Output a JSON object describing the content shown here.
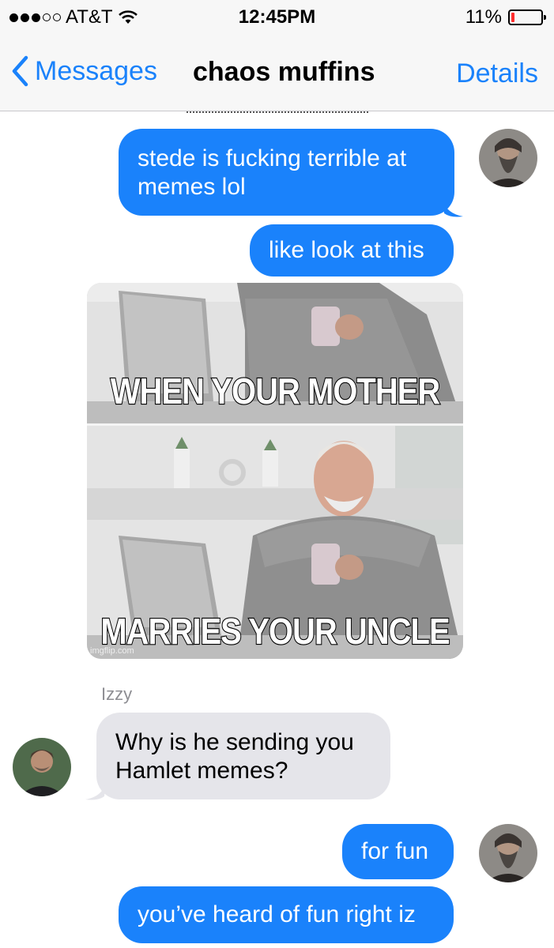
{
  "status_bar": {
    "carrier": "AT&T",
    "time": "12:45PM",
    "battery": "11%",
    "battery_level": 0.11,
    "signal_bars_filled": 3,
    "signal_bars_total": 5,
    "icons": [
      "signal-dots-icon",
      "wifi-icon",
      "battery-icon"
    ]
  },
  "nav": {
    "back_label": "Messages",
    "title": "chaos muffins",
    "details_label": "Details"
  },
  "messages": [
    {
      "text": "stede is fucking terrible at memes lol"
    },
    {
      "text": "like look at this"
    },
    {
      "meme_top": "WHEN YOUR MOTHER",
      "meme_bottom": "MARRIES YOUR UNCLE",
      "watermark": "imgflip.com"
    },
    {
      "sender": "Izzy",
      "text": "Why is he sending you Hamlet memes?"
    },
    {
      "text": "for fun"
    },
    {
      "text": "you’ve heard of fun right iz"
    }
  ],
  "colors": {
    "accent": "#1a82fb",
    "outgoing_bubble": "#1a82fb",
    "incoming_bubble": "#e5e5ea",
    "battery_low": "#ff2d2d"
  }
}
